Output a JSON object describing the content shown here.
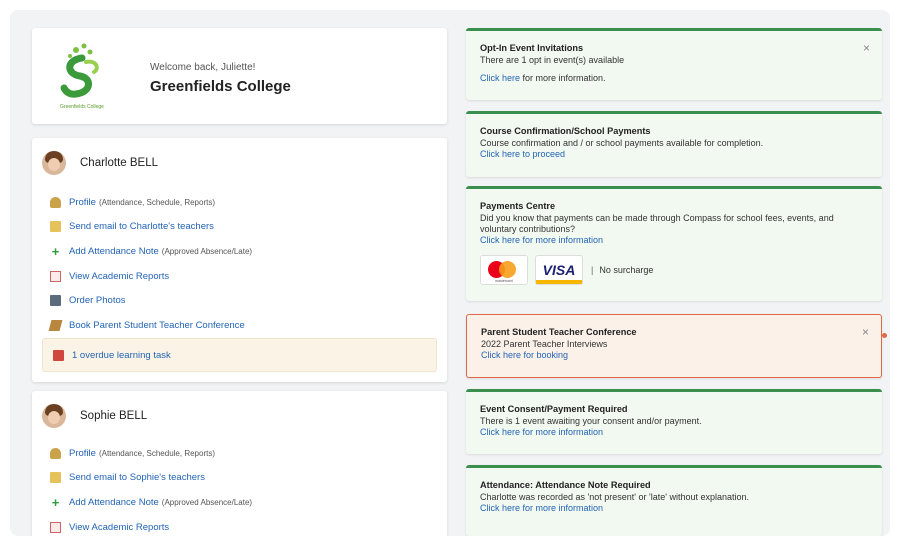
{
  "welcome": {
    "greeting": "Welcome back, Juliette!",
    "school_name": "Greenfields College",
    "logo_text": "Greenfields College"
  },
  "students": [
    {
      "name": "Charlotte BELL",
      "links": {
        "profile": "Profile",
        "profile_note": "(Attendance, Schedule, Reports)",
        "email": "Send email to Charlotte's teachers",
        "attendance": "Add Attendance Note",
        "attendance_note": "(Approved Absence/Late)",
        "reports": "View Academic Reports",
        "photos": "Order Photos",
        "conference": "Book Parent Student Teacher Conference"
      },
      "overdue": "1 overdue learning task"
    },
    {
      "name": "Sophie BELL",
      "links": {
        "profile": "Profile",
        "profile_note": "(Attendance, Schedule, Reports)",
        "email": "Send email to Sophie's teachers",
        "attendance": "Add Attendance Note",
        "attendance_note": "(Approved Absence/Late)",
        "reports": "View Academic Reports"
      }
    }
  ],
  "notices": {
    "optin": {
      "title": "Opt-In Event Invitations",
      "text": "There are 1 opt in event(s) available",
      "link": "Click here",
      "link_suffix": " for more information."
    },
    "course": {
      "title": "Course Confirmation/School Payments",
      "text": "Course confirmation and / or school payments available for completion.",
      "link": "Click here to proceed"
    },
    "payments": {
      "title": "Payments Centre",
      "text": "Did you know that payments can be made through Compass for school fees, events, and voluntary contributions?",
      "link": "Click here for more information",
      "mastercard_text": "mastercard",
      "visa_text": "VISA",
      "separator": "|",
      "no_surcharge": "No surcharge"
    },
    "conference": {
      "title": "Parent Student Teacher Conference",
      "text": "2022 Parent Teacher Interviews",
      "link": "Click here for booking"
    },
    "consent": {
      "title": "Event Consent/Payment Required",
      "text": "There is 1 event awaiting your consent and/or payment.",
      "link": "Click here for more information"
    },
    "attendance": {
      "title": "Attendance: Attendance Note Required",
      "text": "Charlotte was recorded as 'not present' or 'late' without explanation.",
      "link": "Click here for more information"
    },
    "close_glyph": "×"
  },
  "colors": {
    "accent_green": "#3a8f4f",
    "link_blue": "#2364b5",
    "highlight_orange": "#e06a47"
  }
}
